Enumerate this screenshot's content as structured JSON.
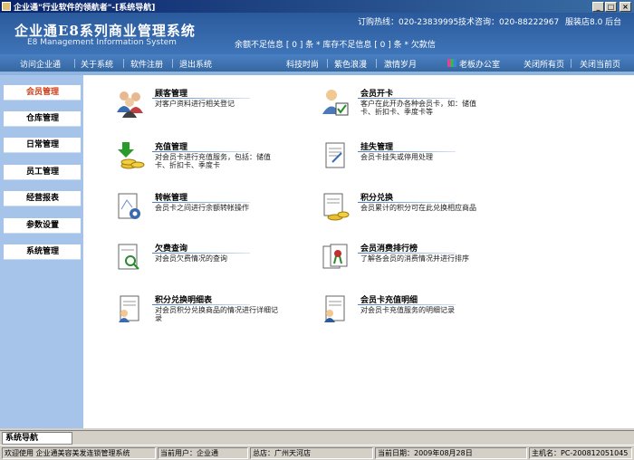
{
  "window": {
    "title": "企业通\"行业软件的领航者\"-[系统导航]",
    "buttons": [
      "_",
      "□",
      "×"
    ]
  },
  "header": {
    "app_name": "企业通E8系列商业管理系统",
    "app_subtitle": "E8 Management Information System",
    "hotline": "订购热线：020-23839995",
    "support": "技术咨询：020-88222967",
    "version": "服装店8.0 后台",
    "alerts": "余额不足信息 [ 0 ] 条   * 库存不足信息 [ 0 ] 条   * 欠款信"
  },
  "menu": {
    "visit": "访问企业通",
    "about": "关于系统",
    "register": "软件注册",
    "exit": "退出系统",
    "theme1": "科技时尚",
    "theme2": "紫色浪漫",
    "theme3": "激情岁月",
    "theme4": "老板办公室",
    "close_all": "关闭所有页",
    "close_current": "关闭当前页"
  },
  "sidebar": {
    "items": [
      {
        "label": "会员管理"
      },
      {
        "label": "仓库管理"
      },
      {
        "label": "日常管理"
      },
      {
        "label": "员工管理"
      },
      {
        "label": "经营报表"
      },
      {
        "label": "参数设置"
      },
      {
        "label": "系统管理"
      }
    ]
  },
  "features": [
    {
      "title": "顾客管理",
      "desc": "对客户资料进行相关登记",
      "icon": "customers-icon"
    },
    {
      "title": "会员开卡",
      "desc": "客户在此开办各种会员卡，如：储值卡、折扣卡、季度卡等",
      "icon": "member-card-icon"
    },
    {
      "title": "充值管理",
      "desc": "对会员卡进行充值服务，包括：储值卡、折扣卡、季度卡",
      "icon": "recharge-icon"
    },
    {
      "title": "挂失管理",
      "desc": "会员卡挂失或停用处理",
      "icon": "report-loss-icon"
    },
    {
      "title": "转帐管理",
      "desc": "会员卡之间进行余额转帐操作",
      "icon": "transfer-icon"
    },
    {
      "title": "积分兑换",
      "desc": "会员累计的积分可在此兑换相应商品",
      "icon": "points-exchange-icon"
    },
    {
      "title": "欠费查询",
      "desc": "对会员欠费情况的查询",
      "icon": "arrears-query-icon"
    },
    {
      "title": "会员消费排行榜",
      "desc": "了解各会员的消费情况并进行排序",
      "icon": "ranking-icon"
    },
    {
      "title": "积分兑换明细表",
      "desc": "对会员积分兑换商品的情况进行详细记录",
      "icon": "points-detail-icon"
    },
    {
      "title": "会员卡充值明细",
      "desc": "对会员卡充值服务的明细记录",
      "icon": "recharge-detail-icon"
    }
  ],
  "bottom_tab": "系统导航",
  "status": {
    "welcome": "欢迎使用 企业通美容美发连锁管理系统",
    "user": "当前用户：企业通",
    "store": "总店：广州天河店",
    "date": "当前日期：2009年08月28日",
    "host": "主机名：PC-200812051045"
  },
  "colors": {
    "header_bg": "#2a5a9c",
    "sidebar_bg": "#a6c4ea",
    "active_item": "#d0401a"
  }
}
